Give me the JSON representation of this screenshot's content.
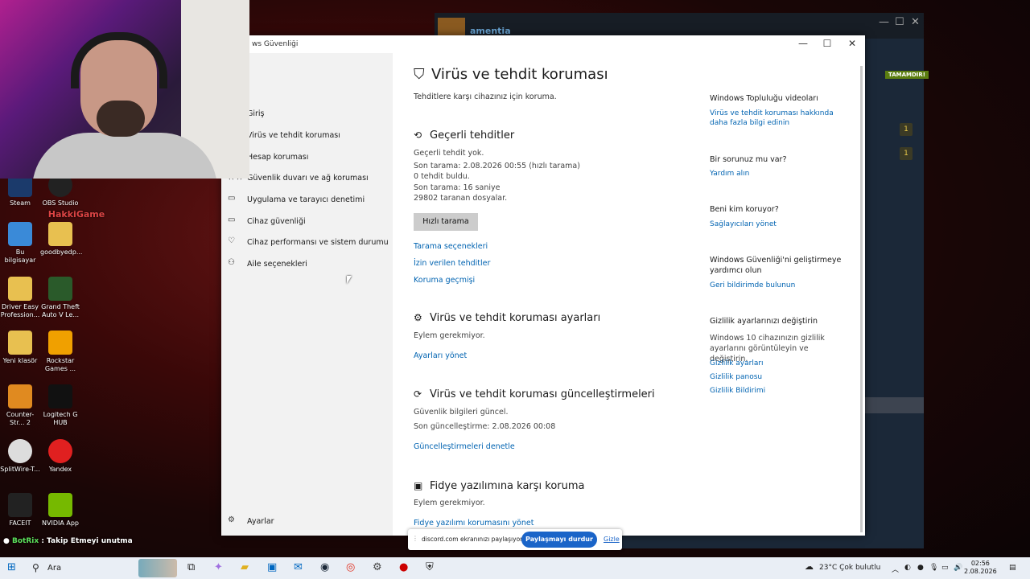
{
  "webcam": {
    "label": "webcam overlay"
  },
  "steam": {
    "username": "amentia",
    "badge": "TAMAMDIR!",
    "notif1": "1",
    "notif2": "1"
  },
  "desktop": {
    "icons": [
      "Steam",
      "OBS Studio",
      "Bu bilgisayar",
      "goodbyedp...",
      "Driver Easy Profession...",
      "Grand Theft Auto V Le...",
      "Yeni klasör",
      "Rockstar Games ...",
      "Counter-Str... 2",
      "Logitech G HUB",
      "SplitWire-T...",
      "Yandex",
      "FACEIT",
      "NVIDIA App"
    ],
    "overlay": "HakkiGame"
  },
  "window": {
    "title": "ws Güvenliği",
    "minimize": "—",
    "maximize": "☐",
    "close": "✕"
  },
  "sidebar": {
    "items": [
      {
        "label": "Giriş",
        "icon": "⌂"
      },
      {
        "label": "Virüs ve tehdit koruması",
        "icon": "⛨"
      },
      {
        "label": "Hesap koruması",
        "icon": "👤"
      },
      {
        "label": "Güvenlik duvarı ve ağ koruması",
        "icon": "((·))"
      },
      {
        "label": "Uygulama ve tarayıcı denetimi",
        "icon": "▭"
      },
      {
        "label": "Cihaz güvenliği",
        "icon": "▭"
      },
      {
        "label": "Cihaz performansı ve sistem durumu",
        "icon": "♡"
      },
      {
        "label": "Aile seçenekleri",
        "icon": "⚇"
      }
    ],
    "settings": "Ayarlar"
  },
  "main": {
    "title": "Virüs ve tehdit koruması",
    "subtitle": "Tehditlere karşı cihazınız için koruma.",
    "current": {
      "heading": "Geçerli tehditler",
      "lines": [
        "Geçerli tehdit yok.",
        "Son tarama: 2.08.2026 00:55 (hızlı tarama)",
        "0 tehdit buldu.",
        "Son tarama: 16 saniye",
        "29802 taranan dosyalar."
      ],
      "button": "Hızlı tarama",
      "links": [
        "Tarama seçenekleri",
        "İzin verilen tehditler",
        "Koruma geçmişi"
      ]
    },
    "settings": {
      "heading": "Virüs ve tehdit koruması ayarları",
      "text": "Eylem gerekmiyor.",
      "link": "Ayarları yönet"
    },
    "updates": {
      "heading": "Virüs ve tehdit koruması güncelleştirmeleri",
      "text1": "Güvenlik bilgileri güncel.",
      "text2": "Son güncelleştirme: 2.08.2026 00:08",
      "link": "Güncelleştirmeleri denetle"
    },
    "ransomware": {
      "heading": "Fidye yazılımına karşı koruma",
      "text": "Eylem gerekmiyor.",
      "link": "Fidye yazılımı korumasını yönet"
    }
  },
  "right": {
    "community": {
      "heading": "Windows Topluluğu videoları",
      "link": "Virüs ve tehdit koruması hakkında daha fazla bilgi edinin"
    },
    "question": {
      "heading": "Bir sorunuz mu var?",
      "link": "Yardım alın"
    },
    "who": {
      "heading": "Beni kim koruyor?",
      "link": "Sağlayıcıları yönet"
    },
    "improve": {
      "heading": "Windows Güvenliği'ni geliştirmeye yardımcı olun",
      "link": "Geri bildirimde bulunun"
    },
    "privacy": {
      "heading": "Gizlilik ayarlarınızı değiştirin",
      "text": "Windows 10 cihazınızın gizlilik ayarlarını görüntüleyin ve değiştirin.",
      "links": [
        "Gizlilik ayarları",
        "Gizlilik panosu",
        "Gizlilik Bildirimi"
      ]
    }
  },
  "share": {
    "text": "discord.com ekranınızı paylaşıyor.",
    "stop": "Paylaşmayı durdur",
    "hide": "Gizle"
  },
  "botrix": {
    "name": "BotRix",
    "msg": ": Takip Etmeyi unutma"
  },
  "taskbar": {
    "search": "Ara",
    "weather": "23°C  Çok bulutlu",
    "time": "02:56",
    "date": "2.08.2026"
  }
}
